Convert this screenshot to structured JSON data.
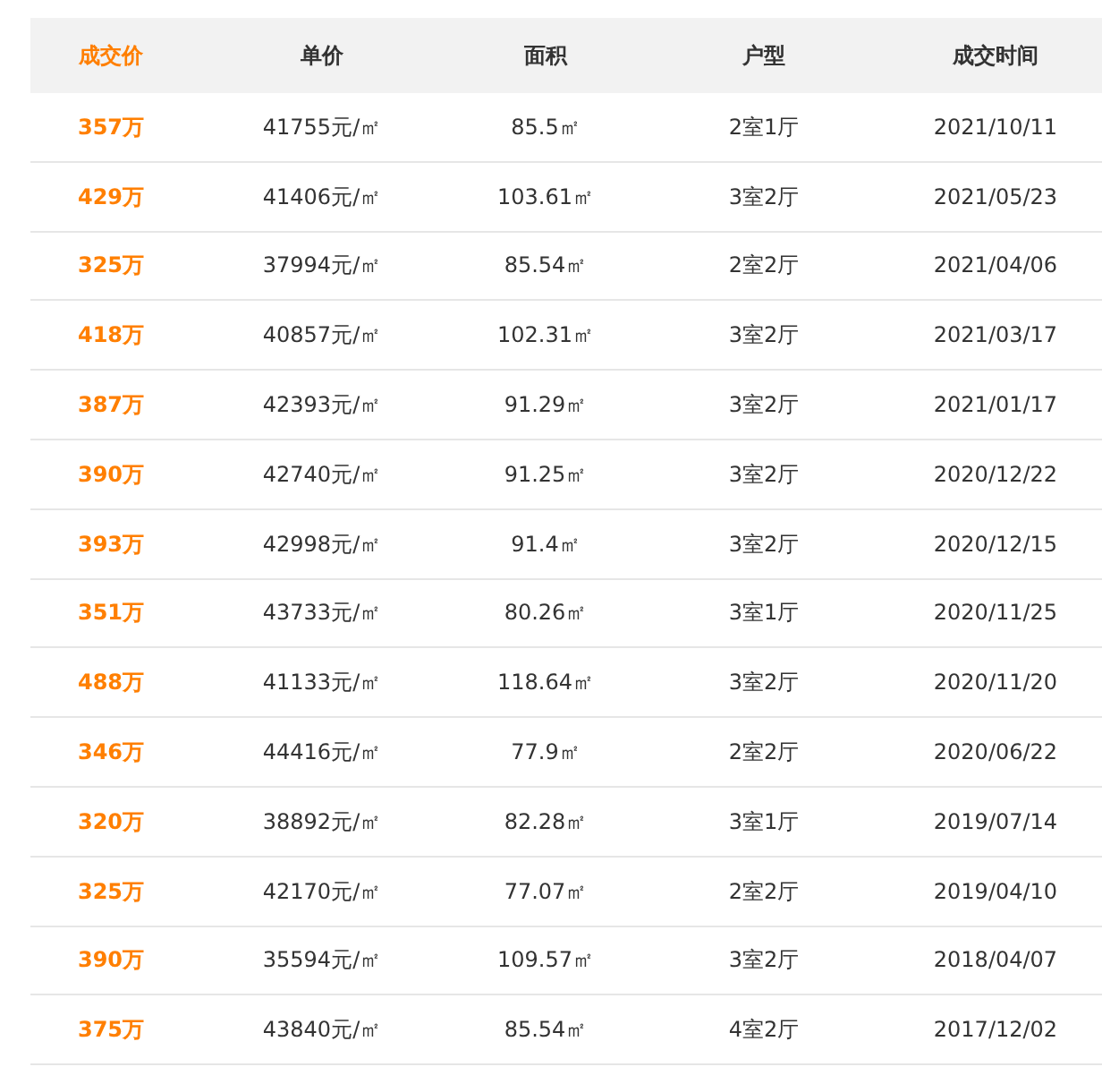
{
  "table": {
    "columns": [
      {
        "label": "成交价",
        "kind": "price"
      },
      {
        "label": "单价",
        "kind": "plain"
      },
      {
        "label": "面积",
        "kind": "plain"
      },
      {
        "label": "户型",
        "kind": "plain"
      },
      {
        "label": "成交时间",
        "kind": "plain"
      }
    ],
    "rows": [
      [
        "357万",
        "41755元/㎡",
        "85.5㎡",
        "2室1厅",
        "2021/10/11"
      ],
      [
        "429万",
        "41406元/㎡",
        "103.61㎡",
        "3室2厅",
        "2021/05/23"
      ],
      [
        "325万",
        "37994元/㎡",
        "85.54㎡",
        "2室2厅",
        "2021/04/06"
      ],
      [
        "418万",
        "40857元/㎡",
        "102.31㎡",
        "3室2厅",
        "2021/03/17"
      ],
      [
        "387万",
        "42393元/㎡",
        "91.29㎡",
        "3室2厅",
        "2021/01/17"
      ],
      [
        "390万",
        "42740元/㎡",
        "91.25㎡",
        "3室2厅",
        "2020/12/22"
      ],
      [
        "393万",
        "42998元/㎡",
        "91.4㎡",
        "3室2厅",
        "2020/12/15"
      ],
      [
        "351万",
        "43733元/㎡",
        "80.26㎡",
        "3室1厅",
        "2020/11/25"
      ],
      [
        "488万",
        "41133元/㎡",
        "118.64㎡",
        "3室2厅",
        "2020/11/20"
      ],
      [
        "346万",
        "44416元/㎡",
        "77.9㎡",
        "2室2厅",
        "2020/06/22"
      ],
      [
        "320万",
        "38892元/㎡",
        "82.28㎡",
        "3室1厅",
        "2019/07/14"
      ],
      [
        "325万",
        "42170元/㎡",
        "77.07㎡",
        "2室2厅",
        "2019/04/10"
      ],
      [
        "390万",
        "35594元/㎡",
        "109.57㎡",
        "3室2厅",
        "2018/04/07"
      ],
      [
        "375万",
        "43840元/㎡",
        "85.54㎡",
        "4室2厅",
        "2017/12/02"
      ]
    ]
  }
}
